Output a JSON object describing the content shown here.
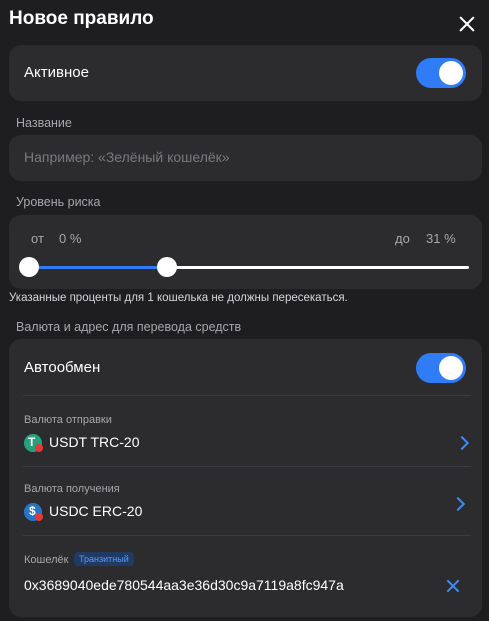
{
  "header": {
    "title": "Новое правило"
  },
  "active": {
    "label": "Активное",
    "enabled": true
  },
  "name_field": {
    "section_label": "Название",
    "placeholder": "Например: «Зелёный кошелёк»",
    "value": ""
  },
  "risk": {
    "section_label": "Уровень риска",
    "from_label": "от",
    "from_value": "0 %",
    "to_label": "до",
    "to_value": "31 %",
    "range_min_percent": 0,
    "range_max_percent": 31,
    "note": "Указанные проценты для 1 кошелька не должны пересекаться."
  },
  "transfer": {
    "section_label": "Валюта и адрес для перевода средств",
    "autoswap": {
      "label": "Автообмен",
      "enabled": true
    },
    "send_currency": {
      "label": "Валюта отправки",
      "value": "USDT TRC-20",
      "icon": "usdt-trc20-icon"
    },
    "receive_currency": {
      "label": "Валюта получения",
      "value": "USDC ERC-20",
      "icon": "usdc-erc20-icon"
    },
    "wallet": {
      "label": "Кошелёк",
      "badge": "Транзитный",
      "address": "0x3689040ede780544aa3e36d30c9a7119a8fc947a"
    }
  },
  "colors": {
    "accent": "#2f7cf6",
    "background": "#1e1e20",
    "card": "#2c2c2e"
  }
}
